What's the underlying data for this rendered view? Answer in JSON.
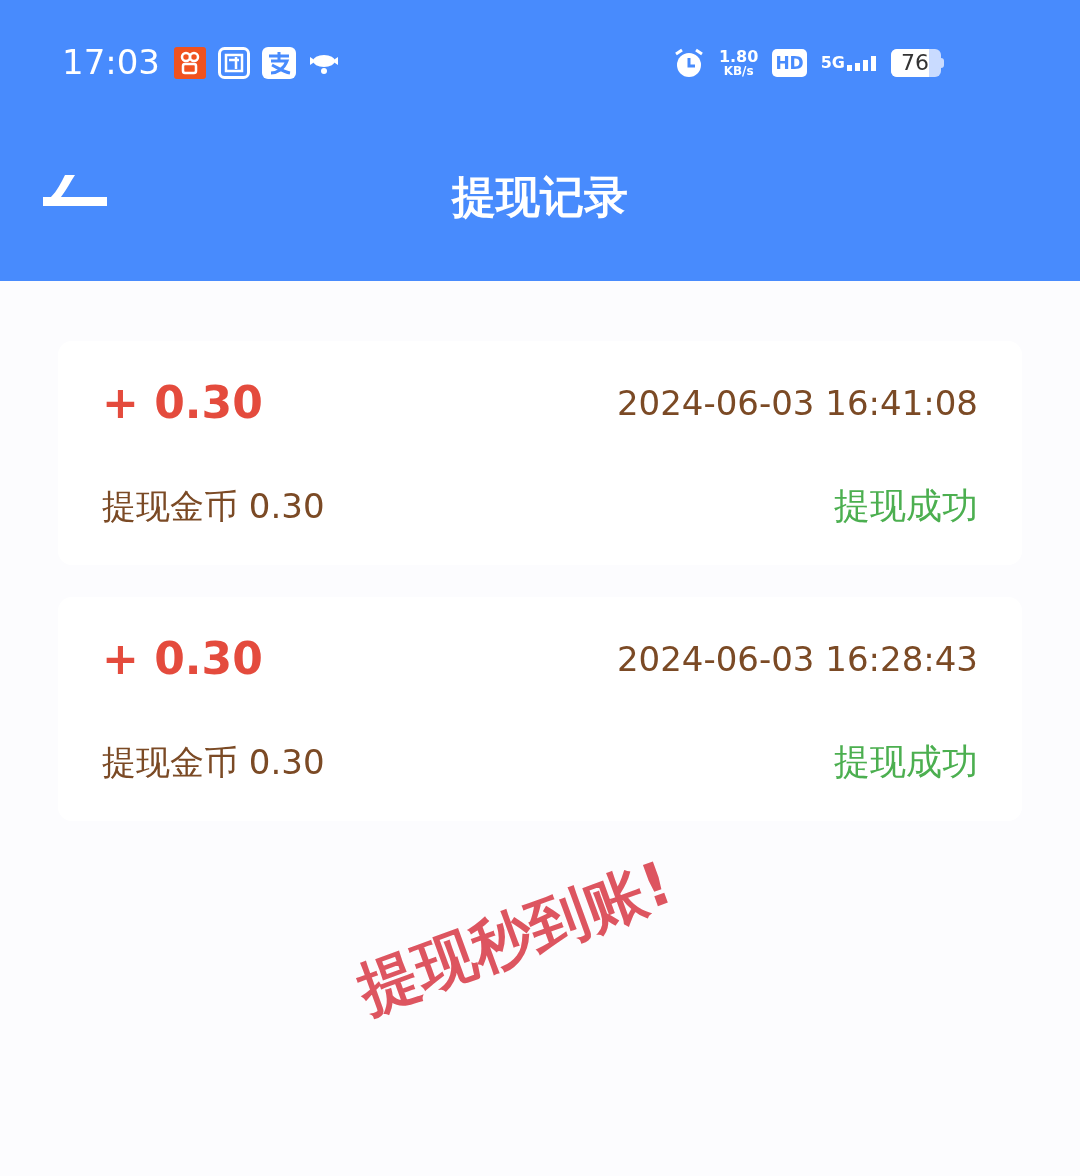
{
  "status_bar": {
    "time": "17:03",
    "speed": "1.80",
    "speed_unit": "KB/s",
    "hd": "HD",
    "network": "5G",
    "battery": "76"
  },
  "header": {
    "title": "提现记录"
  },
  "records": [
    {
      "amount": "+ 0.30",
      "time": "2024-06-03 16:41:08",
      "description": "提现金币 0.30",
      "status": "提现成功"
    },
    {
      "amount": "+ 0.30",
      "time": "2024-06-03 16:28:43",
      "description": "提现金币 0.30",
      "status": "提现成功"
    }
  ],
  "stamp": "提现秒到账!"
}
